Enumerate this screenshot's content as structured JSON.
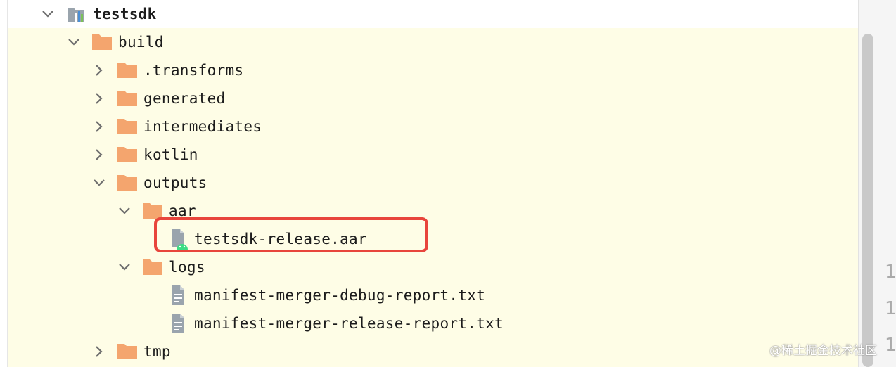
{
  "project_tree": {
    "rows": [
      {
        "label": "testsdk",
        "icon": "module-icon",
        "expanded": true
      },
      {
        "label": "build",
        "icon": "folder-icon",
        "expanded": true
      },
      {
        "label": ".transforms",
        "icon": "folder-icon",
        "expanded": false
      },
      {
        "label": "generated",
        "icon": "folder-icon",
        "expanded": false
      },
      {
        "label": "intermediates",
        "icon": "folder-icon",
        "expanded": false
      },
      {
        "label": "kotlin",
        "icon": "folder-icon",
        "expanded": false
      },
      {
        "label": "outputs",
        "icon": "folder-icon",
        "expanded": true
      },
      {
        "label": "aar",
        "icon": "folder-icon",
        "expanded": true
      },
      {
        "label": "testsdk-release.aar",
        "icon": "aar-file-icon",
        "highlighted": true
      },
      {
        "label": "logs",
        "icon": "folder-icon",
        "expanded": true
      },
      {
        "label": "manifest-merger-debug-report.txt",
        "icon": "text-file-icon"
      },
      {
        "label": "manifest-merger-release-report.txt",
        "icon": "text-file-icon"
      },
      {
        "label": "tmp",
        "icon": "folder-icon",
        "expanded": false
      }
    ]
  },
  "gutter_numbers": [
    "1",
    "1",
    "1"
  ],
  "watermark": "@稀土掘金技术社区",
  "colors": {
    "tree_background": "#fefde6",
    "folder": "#f4a56e",
    "highlight_border": "#e8453c",
    "android_green": "#3ddc84"
  }
}
